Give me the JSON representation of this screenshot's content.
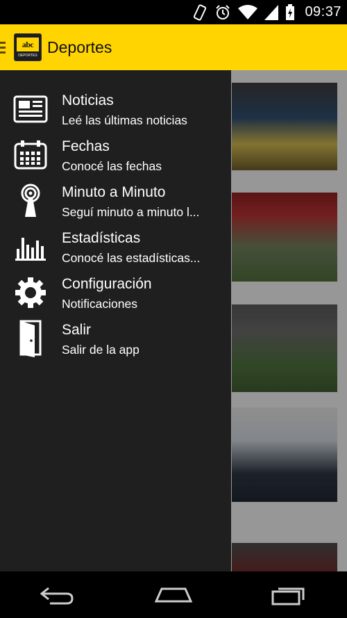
{
  "status_bar": {
    "time": "09:37",
    "icons": [
      "vibrate-icon",
      "alarm-icon",
      "wifi-icon",
      "signal-icon",
      "battery-icon"
    ]
  },
  "action_bar": {
    "title": "Deportes",
    "logo_text": "abc",
    "logo_subtext": "DEPORTES",
    "color": "#ffd400"
  },
  "drawer": {
    "items": [
      {
        "title": "Noticias",
        "subtitle": "Leé las últimas noticias",
        "icon": "newspaper-icon"
      },
      {
        "title": "Fechas",
        "subtitle": "Conocé las fechas",
        "icon": "calendar-icon"
      },
      {
        "title": "Minuto a Minuto",
        "subtitle": "Seguí minuto a minuto l...",
        "icon": "broadcast-icon"
      },
      {
        "title": "Estadísticas",
        "subtitle": "Conocé las estadísticas...",
        "icon": "bar-chart-icon"
      },
      {
        "title": "Configuración",
        "subtitle": "Notificaciones",
        "icon": "gear-icon"
      },
      {
        "title": "Salir",
        "subtitle": "Salir de la app",
        "icon": "exit-door-icon"
      }
    ]
  },
  "nav_bar": {
    "buttons": [
      "back-icon",
      "home-icon",
      "recent-apps-icon"
    ]
  }
}
